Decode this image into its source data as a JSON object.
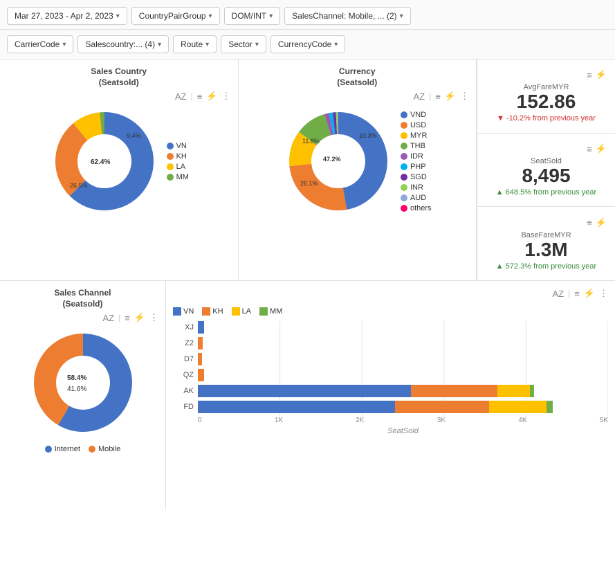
{
  "filters_row1": [
    {
      "label": "Mar 27, 2023 - Apr 2, 2023",
      "name": "date-range-filter"
    },
    {
      "label": "CountryPairGroup",
      "name": "country-pair-filter"
    },
    {
      "label": "DOM/INT",
      "name": "dom-int-filter"
    },
    {
      "label": "SalesChannel: Mobile, ... (2)",
      "name": "sales-channel-filter"
    }
  ],
  "filters_row2": [
    {
      "label": "CarrierCode",
      "name": "carrier-code-filter"
    },
    {
      "label": "Salescountry:... (4)",
      "name": "sales-country-filter"
    },
    {
      "label": "Route",
      "name": "route-filter"
    },
    {
      "label": "Sector",
      "name": "sector-filter"
    },
    {
      "label": "CurrencyCode",
      "name": "currency-code-filter"
    }
  ],
  "sales_country_chart": {
    "title": "Sales Country\n(Seatsold)",
    "title_line1": "Sales Country",
    "title_line2": "(Seatsold)",
    "segments": [
      {
        "label": "VN",
        "value": 62.4,
        "color": "#4472C4",
        "start": 0
      },
      {
        "label": "KH",
        "value": 26.5,
        "color": "#ED7D31",
        "start": 62.4
      },
      {
        "label": "LA",
        "value": 9.4,
        "color": "#FFC000",
        "start": 88.9
      },
      {
        "label": "MM",
        "value": 1.7,
        "color": "#70AD47",
        "start": 98.3
      }
    ],
    "labels_on_chart": [
      {
        "text": "62.4%",
        "color": "#4472C4"
      },
      {
        "text": "26.5%",
        "color": "#ED7D31"
      },
      {
        "text": "9.4%",
        "color": "#FFC000"
      }
    ]
  },
  "currency_chart": {
    "title_line1": "Currency",
    "title_line2": "(Seatsold)",
    "segments": [
      {
        "label": "VND",
        "value": 47.2,
        "color": "#4472C4"
      },
      {
        "label": "USD",
        "value": 26.1,
        "color": "#ED7D31"
      },
      {
        "label": "MYR",
        "value": 11.8,
        "color": "#FFC000"
      },
      {
        "label": "THB",
        "value": 10.3,
        "color": "#70AD47"
      },
      {
        "label": "IDR",
        "value": 1.5,
        "color": "#9B59B6"
      },
      {
        "label": "PHP",
        "value": 1.2,
        "color": "#00B0F0"
      },
      {
        "label": "SGD",
        "value": 1.0,
        "color": "#7030A0"
      },
      {
        "label": "INR",
        "value": 0.5,
        "color": "#92D050"
      },
      {
        "label": "AUD",
        "value": 0.3,
        "color": "#8EA9DB"
      },
      {
        "label": "others",
        "value": 0.1,
        "color": "#FF0066"
      }
    ],
    "labels_on_chart": [
      {
        "text": "47.2%"
      },
      {
        "text": "26.1%"
      },
      {
        "text": "11.8%"
      },
      {
        "text": "10.3%"
      }
    ]
  },
  "kpi_cards": [
    {
      "label": "AvgFareMYR",
      "value": "152.86",
      "change": "▼ -10.2% from previous year",
      "change_type": "down"
    },
    {
      "label": "SeatSold",
      "value": "8,495",
      "change": "▲ 648.5% from previous year",
      "change_type": "up"
    },
    {
      "label": "BaseFareMYR",
      "value": "1.3M",
      "change": "▲ 572.3% from previous year",
      "change_type": "up"
    }
  ],
  "sales_channel_chart": {
    "title_line1": "Sales Channel",
    "title_line2": "(Seatsold)",
    "segments": [
      {
        "label": "Internet",
        "value": 58.4,
        "color": "#4472C4"
      },
      {
        "label": "Mobile",
        "value": 41.6,
        "color": "#ED7D31"
      }
    ],
    "labels_on_chart": [
      {
        "text": "58.4%"
      },
      {
        "text": "41.6%"
      }
    ]
  },
  "bar_chart": {
    "legend": [
      {
        "label": "VN",
        "color": "#4472C4"
      },
      {
        "label": "KH",
        "color": "#ED7D31"
      },
      {
        "label": "LA",
        "color": "#FFC000"
      },
      {
        "label": "MM",
        "color": "#70AD47"
      }
    ],
    "rows": [
      {
        "label": "XJ",
        "bars": [
          {
            "color": "#4472C4",
            "pct": 1.5
          },
          {
            "color": "#ED7D31",
            "pct": 0
          },
          {
            "color": "#FFC000",
            "pct": 0
          },
          {
            "color": "#70AD47",
            "pct": 0
          }
        ]
      },
      {
        "label": "Z2",
        "bars": [
          {
            "color": "#4472C4",
            "pct": 0
          },
          {
            "color": "#ED7D31",
            "pct": 1.2
          },
          {
            "color": "#FFC000",
            "pct": 0
          },
          {
            "color": "#70AD47",
            "pct": 0
          }
        ]
      },
      {
        "label": "D7",
        "bars": [
          {
            "color": "#4472C4",
            "pct": 0
          },
          {
            "color": "#ED7D31",
            "pct": 1.0
          },
          {
            "color": "#FFC000",
            "pct": 0
          },
          {
            "color": "#70AD47",
            "pct": 0
          }
        ]
      },
      {
        "label": "QZ",
        "bars": [
          {
            "color": "#4472C4",
            "pct": 0
          },
          {
            "color": "#ED7D31",
            "pct": 1.5
          },
          {
            "color": "#FFC000",
            "pct": 0
          },
          {
            "color": "#70AD47",
            "pct": 0
          }
        ]
      },
      {
        "label": "AK",
        "bars": [
          {
            "color": "#4472C4",
            "pct": 52
          },
          {
            "color": "#ED7D31",
            "pct": 21
          },
          {
            "color": "#FFC000",
            "pct": 8
          },
          {
            "color": "#70AD47",
            "pct": 1
          }
        ]
      },
      {
        "label": "FD",
        "bars": [
          {
            "color": "#4472C4",
            "pct": 48
          },
          {
            "color": "#ED7D31",
            "pct": 23
          },
          {
            "color": "#FFC000",
            "pct": 14
          },
          {
            "color": "#70AD47",
            "pct": 1.5
          }
        ]
      }
    ],
    "x_ticks": [
      "0",
      "1K",
      "2K",
      "3K",
      "4K",
      "5K"
    ],
    "x_label": "SeatSold",
    "max_value": 5000
  },
  "icons": {
    "sort": "AZ",
    "filter": "≡",
    "lightning": "⚡",
    "more": "⋮",
    "chevron": "▾"
  }
}
